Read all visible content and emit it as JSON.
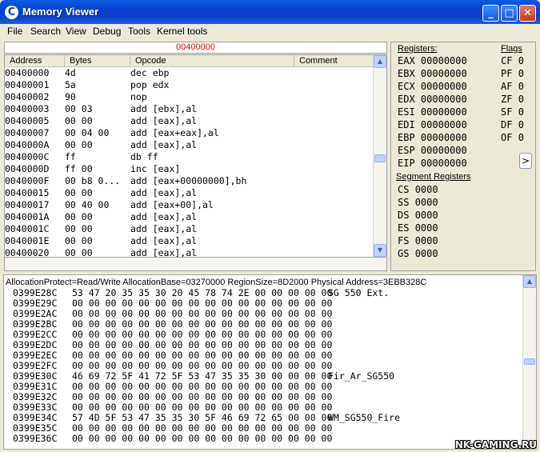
{
  "window": {
    "title": "Memory Viewer",
    "icon": "cheat-engine-icon"
  },
  "menu": [
    "File",
    "Search",
    "View",
    "Debug",
    "Tools",
    "Kernel tools"
  ],
  "disassembler": {
    "current_address": "00400000",
    "columns": [
      "Address",
      "Bytes",
      "Opcode",
      "Comment"
    ],
    "rows": [
      {
        "address": "00400000",
        "bytes": "4d",
        "opcode": "dec ebp"
      },
      {
        "address": "00400001",
        "bytes": "5a",
        "opcode": "pop edx"
      },
      {
        "address": "00400002",
        "bytes": "90",
        "opcode": "nop"
      },
      {
        "address": "00400003",
        "bytes": "00 03",
        "opcode": "add [ebx],al"
      },
      {
        "address": "00400005",
        "bytes": "00 00",
        "opcode": "add [eax],al"
      },
      {
        "address": "00400007",
        "bytes": "00 04 00",
        "opcode": "add [eax+eax],al"
      },
      {
        "address": "0040000A",
        "bytes": "00 00",
        "opcode": "add [eax],al"
      },
      {
        "address": "0040000C",
        "bytes": "ff",
        "opcode": "db ff"
      },
      {
        "address": "0040000D",
        "bytes": "ff 00",
        "opcode": "inc [eax]"
      },
      {
        "address": "0040000F",
        "bytes": "00 b8 0...",
        "opcode": "add [eax+00000000],bh"
      },
      {
        "address": "00400015",
        "bytes": "00 00",
        "opcode": "add [eax],al"
      },
      {
        "address": "00400017",
        "bytes": "00 40 00",
        "opcode": "add [eax+00],al"
      },
      {
        "address": "0040001A",
        "bytes": "00 00",
        "opcode": "add [eax],al"
      },
      {
        "address": "0040001C",
        "bytes": "00 00",
        "opcode": "add [eax],al"
      },
      {
        "address": "0040001E",
        "bytes": "00 00",
        "opcode": "add [eax],al"
      },
      {
        "address": "00400020",
        "bytes": "00 00",
        "opcode": "add [eax],al"
      }
    ]
  },
  "registers": {
    "title": "Registers:",
    "flags_title": "Flags",
    "general": [
      {
        "name": "EAX",
        "value": "00000000"
      },
      {
        "name": "EBX",
        "value": "00000000"
      },
      {
        "name": "ECX",
        "value": "00000000"
      },
      {
        "name": "EDX",
        "value": "00000000"
      },
      {
        "name": "ESI",
        "value": "00000000"
      },
      {
        "name": "EDI",
        "value": "00000000"
      },
      {
        "name": "EBP",
        "value": "00000000"
      },
      {
        "name": "ESP",
        "value": "00000000"
      },
      {
        "name": "EIP",
        "value": "00000000"
      }
    ],
    "flags": [
      {
        "name": "CF",
        "value": "0"
      },
      {
        "name": "PF",
        "value": "0"
      },
      {
        "name": "AF",
        "value": "0"
      },
      {
        "name": "ZF",
        "value": "0"
      },
      {
        "name": "SF",
        "value": "0"
      },
      {
        "name": "DF",
        "value": "0"
      },
      {
        "name": "OF",
        "value": "0"
      }
    ],
    "segment_title": "Segment Registers",
    "segment": [
      {
        "name": "CS",
        "value": "0000"
      },
      {
        "name": "SS",
        "value": "0000"
      },
      {
        "name": "DS",
        "value": "0000"
      },
      {
        "name": "ES",
        "value": "0000"
      },
      {
        "name": "FS",
        "value": "0000"
      },
      {
        "name": "GS",
        "value": "0000"
      }
    ],
    "nav_label": ">"
  },
  "hexview": {
    "info": "AllocationProtect=Read/Write  AllocationBase=03270000 RegionSize=8D2000 Physical Address=3EBB328C",
    "rows": [
      {
        "address": "0399E28C",
        "bytes": "53 47 20 35 35 30 20 45 78 74 2E 00 00 00 00 00",
        "ascii": "SG 550 Ext."
      },
      {
        "address": "0399E29C",
        "bytes": "00 00 00 00 00 00 00 00 00 00 00 00 00 00 00 00",
        "ascii": ""
      },
      {
        "address": "0399E2AC",
        "bytes": "00 00 00 00 00 00 00 00 00 00 00 00 00 00 00 00",
        "ascii": ""
      },
      {
        "address": "0399E2BC",
        "bytes": "00 00 00 00 00 00 00 00 00 00 00 00 00 00 00 00",
        "ascii": ""
      },
      {
        "address": "0399E2CC",
        "bytes": "00 00 00 00 00 00 00 00 00 00 00 00 00 00 00 00",
        "ascii": ""
      },
      {
        "address": "0399E2DC",
        "bytes": "00 00 00 00 00 00 00 00 00 00 00 00 00 00 00 00",
        "ascii": ""
      },
      {
        "address": "0399E2EC",
        "bytes": "00 00 00 00 00 00 00 00 00 00 00 00 00 00 00 00",
        "ascii": ""
      },
      {
        "address": "0399E2FC",
        "bytes": "00 00 00 00 00 00 00 00 00 00 00 00 00 00 00 00",
        "ascii": ""
      },
      {
        "address": "0399E30C",
        "bytes": "46 69 72 5F 41 72 5F 53 47 35 35 30 00 00 00 00",
        "ascii": "Fir_Ar_SG550"
      },
      {
        "address": "0399E31C",
        "bytes": "00 00 00 00 00 00 00 00 00 00 00 00 00 00 00 00",
        "ascii": ""
      },
      {
        "address": "0399E32C",
        "bytes": "00 00 00 00 00 00 00 00 00 00 00 00 00 00 00 00",
        "ascii": ""
      },
      {
        "address": "0399E33C",
        "bytes": "00 00 00 00 00 00 00 00 00 00 00 00 00 00 00 00",
        "ascii": ""
      },
      {
        "address": "0399E34C",
        "bytes": "57 4D 5F 53 47 35 35 30 5F 46 69 72 65 00 00 00",
        "ascii": "WM_SG550_Fire"
      },
      {
        "address": "0399E35C",
        "bytes": "00 00 00 00 00 00 00 00 00 00 00 00 00 00 00 00",
        "ascii": ""
      },
      {
        "address": "0399E36C",
        "bytes": "00 00 00 00 00 00 00 00 00 00 00 00 00 00 00 00",
        "ascii": ""
      }
    ]
  },
  "watermark": "NK-GAMING.RU"
}
